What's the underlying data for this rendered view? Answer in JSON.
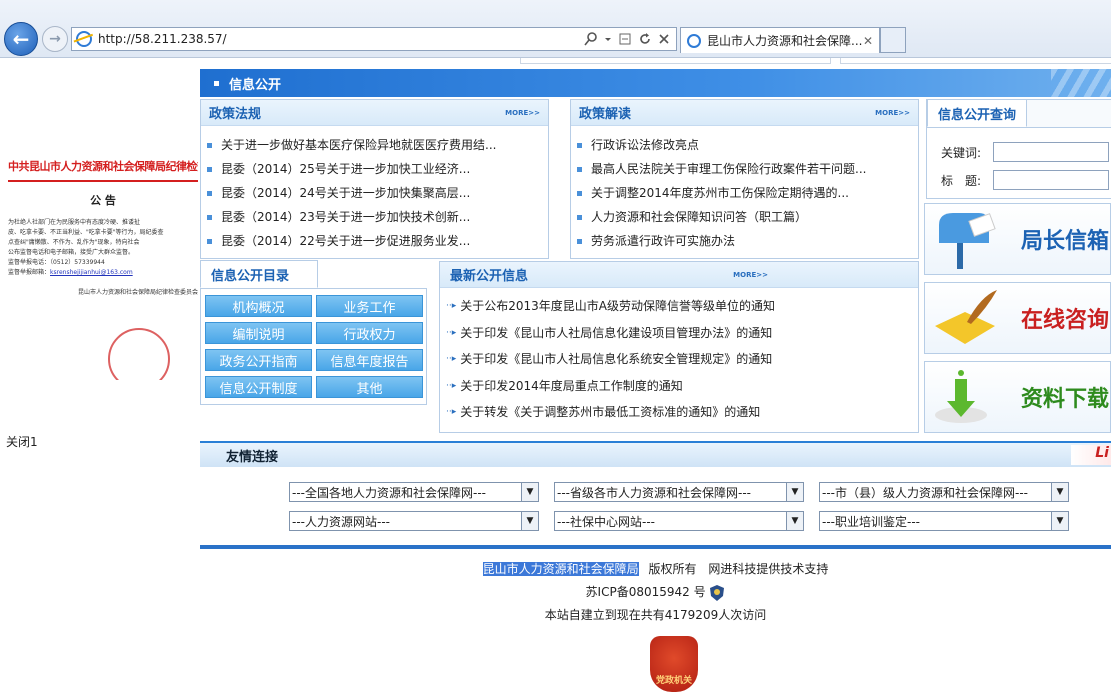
{
  "browser": {
    "url": "http://58.211.238.57/",
    "tab_title": "昆山市人力资源和社会保障...",
    "back_glyph": "←",
    "forward_glyph": "→",
    "close_tab_glyph": "✕"
  },
  "popup": {
    "org_title": "中共昆山市人力资源和社会保障局纪律检查委员会",
    "heading": "公 告",
    "body_lines": [
      "为杜绝人社部门在为民服务中有态度冷硬、推诿扯",
      "皮、吃拿卡要、不正当利益、\"吃拿卡要\"等行为，局纪委查",
      "点查纠\"庸懒散、不作为、乱作为\"现象，特向社会",
      "公布监督电话和电子邮箱，接受广大群众监督。",
      "监督举报电话：（0512）57339944",
      "监督举报邮箱："
    ],
    "email": "ksrenshejijianhui@163.com",
    "signature": "昆山市人力资源和社会保障局纪律检查委员会",
    "close_label": "关闭1"
  },
  "section_title": "信息公开",
  "policy_laws": {
    "title": "政策法规",
    "more": "MORE>>",
    "items": [
      "关于进一步做好基本医疗保险异地就医医疗费用结...",
      "昆委（2014）25号关于进一步加快工业经济...",
      "昆委（2014）24号关于进一步加快集聚高层...",
      "昆委（2014）23号关于进一步加快技术创新...",
      "昆委（2014）22号关于进一步促进服务业发..."
    ]
  },
  "policy_interpret": {
    "title": "政策解读",
    "more": "MORE>>",
    "items": [
      "行政诉讼法修改亮点",
      "最高人民法院关于审理工伤保险行政案件若干问题...",
      "关于调整2014年度苏州市工伤保险定期待遇的...",
      "人力资源和社会保障知识问答（职工篇）",
      "劳务派遣行政许可实施办法"
    ]
  },
  "query": {
    "title": "信息公开查询",
    "keyword_label": "关键词:",
    "title_label": "标　题:"
  },
  "catalog": {
    "title": "信息公开目录",
    "items": [
      "机构概况",
      "业务工作",
      "编制说明",
      "行政权力",
      "政务公开指南",
      "信息年度报告",
      "信息公开制度",
      "其他"
    ]
  },
  "latest": {
    "title": "最新公开信息",
    "more": "MORE>>",
    "items": [
      "关于公布2013年度昆山市A级劳动保障信誉等级单位的通知",
      "关于印发《昆山市人社局信息化建设项目管理办法》的通知",
      "关于印发《昆山市人社局信息化系统安全管理规定》的通知",
      "关于印发2014年度局重点工作制度的通知",
      "关于转发《关于调整苏州市最低工资标准的通知》的通知"
    ]
  },
  "banners": [
    {
      "label": "局长信箱",
      "color": "#1c62b3"
    },
    {
      "label": "在线咨询",
      "color": "#c92020"
    },
    {
      "label": "资料下载",
      "color": "#2e8b1e"
    }
  ],
  "friend_links": {
    "title": "友情连接",
    "corner": "Li",
    "selects": [
      "---全国各地人力资源和社会保障网---",
      "---省级各市人力资源和社会保障网---",
      "---市（县）级人力资源和社会保障网---",
      "---人力资源网站---",
      "---社保中心网站---",
      "---职业培训鉴定---"
    ]
  },
  "footer": {
    "org": "昆山市人力资源和社会保障局",
    "copyright": "版权所有",
    "tech": "网进科技提供技术支持",
    "icp": "苏ICP备08015942 号",
    "visits": "本站自建立到现在共有4179209人次访问",
    "badge": "党政机关"
  }
}
